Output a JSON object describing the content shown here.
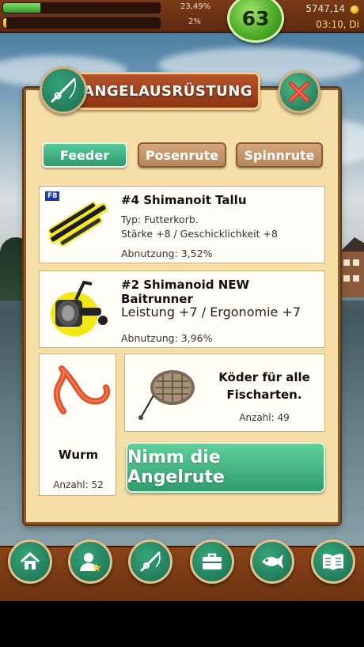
{
  "hud": {
    "xp_percent": "23,49%",
    "xp_fill": 0.2349,
    "second_percent": "2%",
    "second_fill": 0.02,
    "level": "63",
    "money": "5747,14",
    "time": "03:10, Di"
  },
  "dialog": {
    "title": "ANGELAUSRÜSTUNG",
    "tabs": [
      {
        "label": "Feeder",
        "active": true
      },
      {
        "label": "Posenrute",
        "active": false
      },
      {
        "label": "Spinnrute",
        "active": false
      }
    ],
    "rod": {
      "hotkey": "F8",
      "name": "#4 Shimanoit Tallu",
      "type": "Typ: Futterkorb.",
      "stats": "Stärke +8 / Geschicklichkeit +8",
      "wear": "Abnutzung: 3,52%"
    },
    "reel": {
      "name": "#2 Shimanoid NEW Baitrunner",
      "stats": "Leistung +7 / Ergonomie +7",
      "wear": "Abnutzung: 3,96%"
    },
    "bait": {
      "name": "Wurm",
      "count": "Anzahl: 52"
    },
    "feeder": {
      "label": "Köder für alle Fischarten.",
      "count": "Anzahl: 49"
    },
    "take_button": "Nimm die Angelrute"
  },
  "colors": {
    "accent_green": "#2f9c6c",
    "panel_bg": "#f6dfa7",
    "wood": "#7a3a17"
  },
  "nav": {
    "icons": [
      "home-icon",
      "profile-icon",
      "fishing-rod-icon",
      "briefcase-icon",
      "fish-icon",
      "book-icon"
    ]
  }
}
